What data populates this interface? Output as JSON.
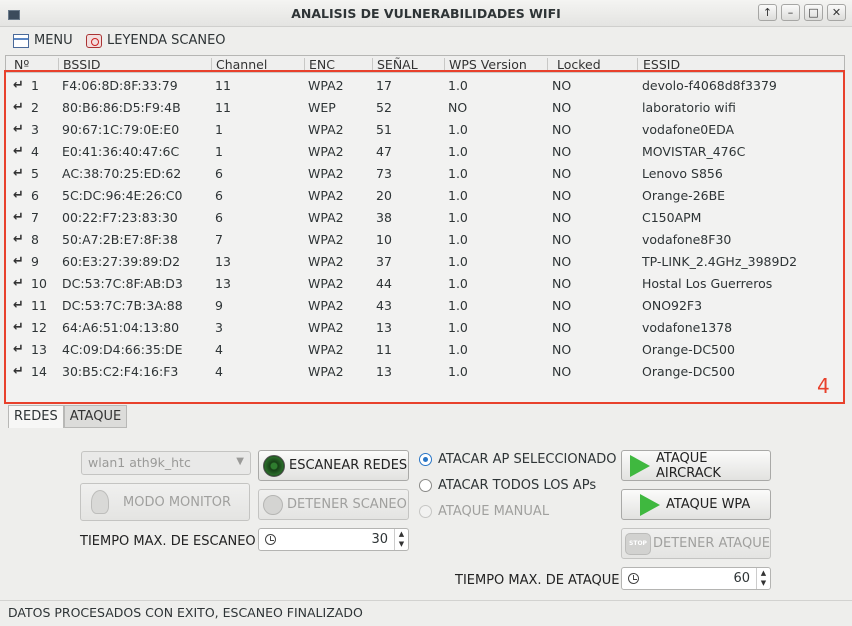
{
  "window": {
    "title": "ANALISIS DE VULNERABILIDADES WIFI",
    "controls": [
      "↑",
      "–",
      "□",
      "✕"
    ]
  },
  "menu": {
    "menu_label": "MENU",
    "legend_label": "LEYENDA SCANEO"
  },
  "table": {
    "columns": [
      "Nº",
      "BSSID",
      "Channel",
      "ENC",
      "SEÑAL",
      "WPS Version",
      "Locked",
      "ESSID"
    ],
    "rows": [
      {
        "n": "1",
        "bssid": "F4:06:8D:8F:33:79",
        "channel": "11",
        "enc": "WPA2",
        "signal": "17",
        "wps": "1.0",
        "locked": "NO",
        "essid": "devolo-f4068d8f3379"
      },
      {
        "n": "2",
        "bssid": "80:B6:86:D5:F9:4B",
        "channel": "11",
        "enc": "WEP",
        "signal": "52",
        "wps": "NO",
        "locked": "NO",
        "essid": "laboratorio wifi"
      },
      {
        "n": "3",
        "bssid": "90:67:1C:79:0E:E0",
        "channel": "1",
        "enc": "WPA2",
        "signal": "51",
        "wps": "1.0",
        "locked": "NO",
        "essid": "vodafone0EDA"
      },
      {
        "n": "4",
        "bssid": "E0:41:36:40:47:6C",
        "channel": "1",
        "enc": "WPA2",
        "signal": "47",
        "wps": "1.0",
        "locked": "NO",
        "essid": "MOVISTAR_476C"
      },
      {
        "n": "5",
        "bssid": "AC:38:70:25:ED:62",
        "channel": "6",
        "enc": "WPA2",
        "signal": "73",
        "wps": "1.0",
        "locked": "NO",
        "essid": "Lenovo S856"
      },
      {
        "n": "6",
        "bssid": "5C:DC:96:4E:26:C0",
        "channel": "6",
        "enc": "WPA2",
        "signal": "20",
        "wps": "1.0",
        "locked": "NO",
        "essid": "Orange-26BE"
      },
      {
        "n": "7",
        "bssid": "00:22:F7:23:83:30",
        "channel": "6",
        "enc": "WPA2",
        "signal": "38",
        "wps": "1.0",
        "locked": "NO",
        "essid": "C150APM"
      },
      {
        "n": "8",
        "bssid": "50:A7:2B:E7:8F:38",
        "channel": "7",
        "enc": "WPA2",
        "signal": "10",
        "wps": "1.0",
        "locked": "NO",
        "essid": "vodafone8F30"
      },
      {
        "n": "9",
        "bssid": "60:E3:27:39:89:D2",
        "channel": "13",
        "enc": "WPA2",
        "signal": "37",
        "wps": "1.0",
        "locked": "NO",
        "essid": "TP-LINK_2.4GHz_3989D2"
      },
      {
        "n": "10",
        "bssid": "DC:53:7C:8F:AB:D3",
        "channel": "13",
        "enc": "WPA2",
        "signal": "44",
        "wps": "1.0",
        "locked": "NO",
        "essid": "Hostal Los Guerreros"
      },
      {
        "n": "11",
        "bssid": "DC:53:7C:7B:3A:88",
        "channel": "9",
        "enc": "WPA2",
        "signal": "43",
        "wps": "1.0",
        "locked": "NO",
        "essid": "ONO92F3"
      },
      {
        "n": "12",
        "bssid": "64:A6:51:04:13:80",
        "channel": "3",
        "enc": "WPA2",
        "signal": "13",
        "wps": "1.0",
        "locked": "NO",
        "essid": "vodafone1378"
      },
      {
        "n": "13",
        "bssid": "4C:09:D4:66:35:DE",
        "channel": "4",
        "enc": "WPA2",
        "signal": "11",
        "wps": "1.0",
        "locked": "NO",
        "essid": "Orange-DC500"
      },
      {
        "n": "14",
        "bssid": "30:B5:C2:F4:16:F3",
        "channel": "4",
        "enc": "WPA2",
        "signal": "13",
        "wps": "1.0",
        "locked": "NO",
        "essid": "Orange-DC500"
      }
    ],
    "row_icon": "↵",
    "annotation_number": "4"
  },
  "tabs": {
    "redes": "REDES",
    "ataque": "ATAQUE"
  },
  "controls": {
    "interface_value": "wlan1 ath9k_htc",
    "scan_button": "ESCANEAR REDES",
    "monitor_button": "MODO MONITOR",
    "stop_scan_button": "DETENER SCANEO",
    "scan_time_label": "TIEMPO MAX. DE ESCANEO",
    "scan_time_value": "30",
    "radio_selected": "ATACAR AP SELECCIONADO",
    "radio_all": "ATACAR TODOS LOS APs",
    "radio_manual": "ATAQUE MANUAL",
    "aircrack_button": "ATAQUE AIRCRACK",
    "wpa_button": "ATAQUE WPA",
    "stop_attack_button": "DETENER ATAQUE",
    "attack_time_label": "TIEMPO MAX. DE ATAQUE",
    "attack_time_value": "60",
    "stop_sign_text": "STOP"
  },
  "status": {
    "message": "DATOS PROCESADOS CON EXITO, ESCANEO FINALIZADO"
  },
  "colors": {
    "annotation": "#e8412c",
    "radio_accent": "#2a76c6",
    "play_icon": "#3fb83f"
  }
}
